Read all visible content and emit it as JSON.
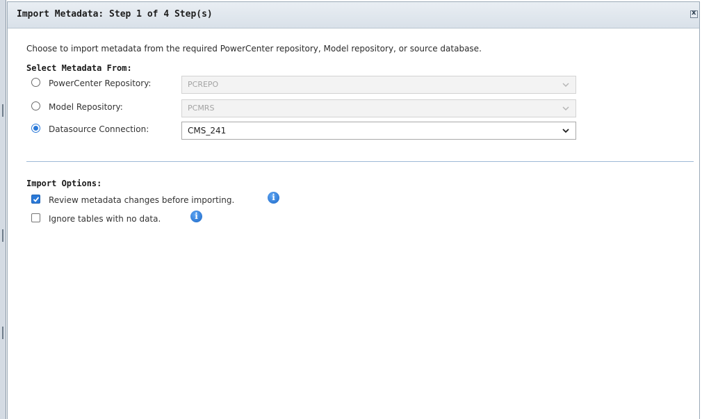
{
  "dialog": {
    "title": "Import Metadata: Step 1 of 4 Step(s)",
    "close_label": "x",
    "intro": "Choose to import metadata from the required PowerCenter repository, Model repository, or source database."
  },
  "select_metadata": {
    "heading": "Select Metadata From:",
    "options": [
      {
        "label": "PowerCenter Repository:",
        "value": "PCREPO",
        "selected": false,
        "enabled": false
      },
      {
        "label": "Model Repository:",
        "value": "PCMRS",
        "selected": false,
        "enabled": false
      },
      {
        "label": "Datasource Connection:",
        "value": "CMS_241",
        "selected": true,
        "enabled": true
      }
    ]
  },
  "import_options": {
    "heading": "Import Options:",
    "options": [
      {
        "label": "Review metadata changes before importing.",
        "checked": true
      },
      {
        "label": "Ignore tables with no data.",
        "checked": false
      }
    ],
    "info_glyph": "i"
  },
  "icons": {
    "info": "info-icon",
    "chevron": "chevron-down-icon",
    "close": "close-icon"
  },
  "colors": {
    "accent": "#2a79d8",
    "title_bar": "#dfe6ed",
    "divider": "#9db9d6"
  }
}
